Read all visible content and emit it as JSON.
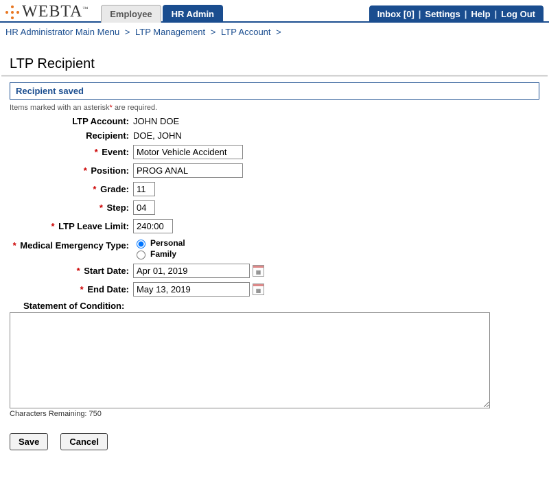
{
  "brand": {
    "name": "WEBTA",
    "tm": "™"
  },
  "tabs": {
    "employee": "Employee",
    "hr_admin": "HR Admin"
  },
  "top_nav": {
    "inbox_label": "Inbox [0]",
    "settings": "Settings",
    "help": "Help",
    "logout": "Log Out"
  },
  "breadcrumb": {
    "b1": "HR Administrator Main Menu",
    "b2": "LTP Management",
    "b3": "LTP Account"
  },
  "page_title": "LTP Recipient",
  "status_message": "Recipient saved",
  "required_note_text": "Items marked with an asterisk* are required.",
  "fields": {
    "ltp_account": {
      "label": "LTP Account:",
      "value": "JOHN DOE"
    },
    "recipient": {
      "label": "Recipient:",
      "value": "DOE, JOHN"
    },
    "event": {
      "label": "Event:",
      "value": "Motor Vehicle Accident"
    },
    "position": {
      "label": "Position:",
      "value": "PROG ANAL"
    },
    "grade": {
      "label": "Grade:",
      "value": "11"
    },
    "step": {
      "label": "Step:",
      "value": "04"
    },
    "ltp_leave_limit": {
      "label": "LTP Leave Limit:",
      "value": "240:00"
    },
    "medical_emergency": {
      "label": "Medical Emergency Type:",
      "options": {
        "personal": "Personal",
        "family": "Family"
      },
      "selected": "personal"
    },
    "start_date": {
      "label": "Start Date:",
      "value": "Apr 01, 2019"
    },
    "end_date": {
      "label": "End Date:",
      "value": "May 13, 2019"
    },
    "statement": {
      "label": "Statement of Condition:",
      "value": "",
      "char_remaining_label": "Characters Remaining: 750"
    }
  },
  "buttons": {
    "save": "Save",
    "cancel": "Cancel"
  }
}
